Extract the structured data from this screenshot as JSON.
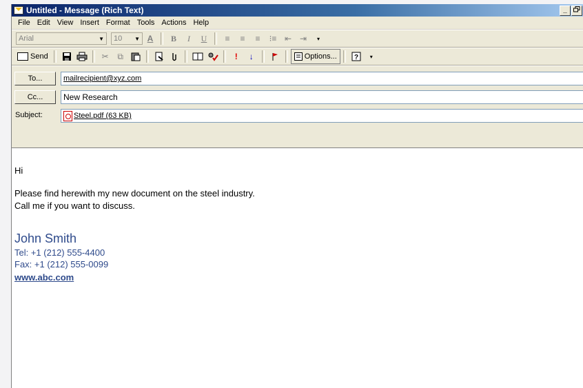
{
  "window": {
    "title": "Untitled - Message (Rich Text)",
    "minimize_label": "_",
    "restore_label": " "
  },
  "menu": {
    "items": [
      {
        "label": "File"
      },
      {
        "label": "Edit"
      },
      {
        "label": "View"
      },
      {
        "label": "Insert"
      },
      {
        "label": "Format"
      },
      {
        "label": "Tools"
      },
      {
        "label": "Actions"
      },
      {
        "label": "Help"
      }
    ]
  },
  "format_toolbar": {
    "font": "Arial",
    "size": "10",
    "font_color_glyph": "A",
    "bold_glyph": "B",
    "italic_glyph": "I",
    "underline_glyph": "U"
  },
  "standard_toolbar": {
    "send_label": "Send",
    "options_label": "Options..."
  },
  "header": {
    "to_button": "To...",
    "to_value": "mailrecipient@xyz.com",
    "cc_button": "Cc...",
    "cc_value": "New Research",
    "subject_label": "Subject:",
    "attachment": "Steel.pdf (63 KB)"
  },
  "body": {
    "greeting": "Hi",
    "line1": "Please find herewith my new document on the steel industry.",
    "line2": "Call me if you want to discuss.",
    "signature": {
      "name": "John Smith",
      "tel": "Tel:  +1 (212) 555-4400",
      "fax": "Fax:  +1 (212) 555-0099",
      "website": "www.abc.com"
    }
  },
  "colors": {
    "signature": "#2e4a8b",
    "titlebar": "#0a246a"
  }
}
